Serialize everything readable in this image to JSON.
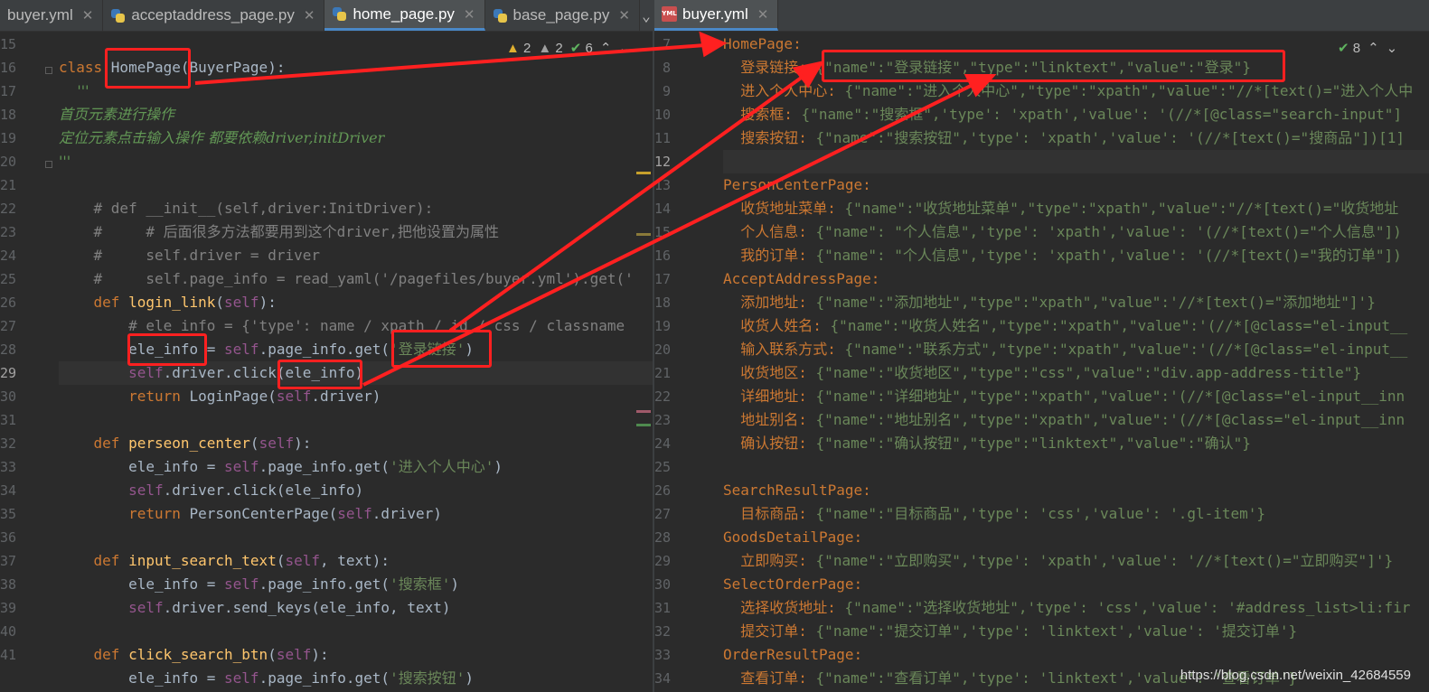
{
  "tabs_left": [
    {
      "label": "buyer.yml",
      "icon": "yml-file-icon",
      "active": false
    },
    {
      "label": "acceptaddress_page.py",
      "icon": "python-file-icon",
      "active": false
    },
    {
      "label": "home_page.py",
      "icon": "python-file-icon",
      "active": true
    },
    {
      "label": "base_page.py",
      "icon": "python-file-icon",
      "active": false
    }
  ],
  "tabs_right": [
    {
      "label": "buyer.yml",
      "icon": "yml-file-icon",
      "active": true
    }
  ],
  "file_icon_text": {
    "yml": "YML"
  },
  "inspection_left": {
    "warnings": "2",
    "weak_warnings": "2",
    "ok": "6"
  },
  "inspection_right": {
    "ok": "8"
  },
  "watermark": "https://blog.csdn.net/weixin_42684559",
  "left_lines": [
    "15",
    "16",
    "17",
    "18",
    "19",
    "20",
    "21",
    "22",
    "23",
    "24",
    "25",
    "26",
    "27",
    "28",
    "29",
    "30",
    "31",
    "32",
    "33",
    "34",
    "35",
    "36",
    "37",
    "38",
    "39",
    "40",
    "41"
  ],
  "right_lines": [
    "7",
    "8",
    "9",
    "10",
    "11",
    "12",
    "13",
    "14",
    "15",
    "16",
    "17",
    "18",
    "19",
    "20",
    "21",
    "22",
    "23",
    "24",
    "25",
    "26",
    "27",
    "28",
    "29",
    "30",
    "31",
    "32",
    "33",
    "34"
  ],
  "py_code": {
    "l16_class": "class ",
    "l16_name": "HomePage",
    "l16_rest": "(BuyerPage):",
    "l17": "    '''",
    "l18": "首页元素进行操作",
    "l19": "定位元素点击输入操作 都要依赖driver,initDriver",
    "l20": "'''",
    "l22": "    # def __init__(self,driver:InitDriver):",
    "l23": "    #     # 后面很多方法都要用到这个driver,把他设置为属性",
    "l24": "    #     self.driver = driver",
    "l25": "    #     self.page_info = read_yaml('/pagefiles/buyer.yml').get('",
    "l26_def": "    def ",
    "l26_fn": "login_link",
    "l26_self": "self",
    "l27": "        # ele_info = {'type': name / xpath / id / css / classname",
    "l28_var": "ele_info",
    "l28_mid": ".page_info.get(",
    "l28_str": "'登录链接'",
    "l29_a": ".driver.click(",
    "l29_b": "ele_info",
    "l30_ret": "return ",
    "l30_rest": "LoginPage(",
    "l30_end": ".driver)",
    "l32_fn": "perseon_center",
    "l33_mid": ".page_info.get(",
    "l33_str": "'进入个人中心'",
    "l34": ".driver.click(ele_info)",
    "l35_rest": "PersonCenterPage(",
    "l37_fn": "input_search_text",
    "l37_args": ", text):",
    "l38_str": "'搜索框'",
    "l39": ".driver.send_keys(ele_info, text)",
    "l41_fn": "click_search_btn",
    "l42_str": "'搜索按钮'",
    "self_kw": "self",
    "ele_info_eq": "ele_info = ",
    "eq": " = ",
    "rparen": ")",
    "args_close": "):"
  },
  "yml_code": {
    "r7": "HomePage:",
    "r8_key": "  登录链接: ",
    "r8_val": "{\"name\":\"登录链接\",\"type\":\"linktext\",\"value\":\"登录\"}",
    "r9_key": "  进入个人中心: ",
    "r9_val": "{\"name\":\"进入个人中心\",\"type\":\"xpath\",\"value\":\"//*[text()=\"进入个人中",
    "r10_key": "  搜索框: ",
    "r10_val": "{\"name\":\"搜索框\",'type': 'xpath','value': '(//*[@class=\"search-input\"]",
    "r11_key": "  搜索按钮: ",
    "r11_val": "{\"name\":\"搜索按钮\",'type': 'xpath','value': '(//*[text()=\"搜商品\"])[1]",
    "r13": "PersonCenterPage:",
    "r14_key": "  收货地址菜单: ",
    "r14_val": "{\"name\":\"收货地址菜单\",\"type\":\"xpath\",\"value\":\"//*[text()=\"收货地址",
    "r15_key": "  个人信息: ",
    "r15_val": "{\"name\": \"个人信息\",'type': 'xpath','value': '(//*[text()=\"个人信息\"])",
    "r16_key": "  我的订单: ",
    "r16_val": "{\"name\": \"个人信息\",'type': 'xpath','value': '(//*[text()=\"我的订单\"])",
    "r17": "AcceptAddressPage:",
    "r18_key": "  添加地址: ",
    "r18_val": "{\"name\":\"添加地址\",\"type\":\"xpath\",\"value\":'//*[text()=\"添加地址\"]'}",
    "r19_key": "  收货人姓名: ",
    "r19_val": "{\"name\":\"收货人姓名\",\"type\":\"xpath\",\"value\":'(//*[@class=\"el-input__",
    "r20_key": "  输入联系方式: ",
    "r20_val": "{\"name\":\"联系方式\",\"type\":\"xpath\",\"value\":'(//*[@class=\"el-input__",
    "r21_key": "  收货地区: ",
    "r21_val": "{\"name\":\"收货地区\",\"type\":\"css\",\"value\":\"div.app-address-title\"}",
    "r22_key": "  详细地址: ",
    "r22_val": "{\"name\":\"详细地址\",\"type\":\"xpath\",\"value\":'(//*[@class=\"el-input__inn",
    "r23_key": "  地址别名: ",
    "r23_val": "{\"name\":\"地址别名\",\"type\":\"xpath\",\"value\":'(//*[@class=\"el-input__inn",
    "r24_key": "  确认按钮: ",
    "r24_val": "{\"name\":\"确认按钮\",\"type\":\"linktext\",\"value\":\"确认\"}",
    "r26": "SearchResultPage:",
    "r27_key": "  目标商品: ",
    "r27_val": "{\"name\":\"目标商品\",'type': 'css','value': '.gl-item'}",
    "r28": "GoodsDetailPage:",
    "r29_key": "  立即购买: ",
    "r29_val": "{\"name\":\"立即购买\",'type': 'xpath','value': '//*[text()=\"立即购买\"]'}",
    "r30": "SelectOrderPage:",
    "r31_key": "  选择收货地址: ",
    "r31_val": "{\"name\":\"选择收货地址\",'type': 'css','value': '#address_list>li:fir",
    "r32_key": "  提交订单: ",
    "r32_val": "{\"name\":\"提交订单\",'type': 'linktext','value': '提交订单'}",
    "r33": "OrderResultPage:",
    "r34_key": "  查看订单: ",
    "r34_val": "{\"name\":\"查看订单\",'type': 'linktext','value': '查看订单'}"
  }
}
